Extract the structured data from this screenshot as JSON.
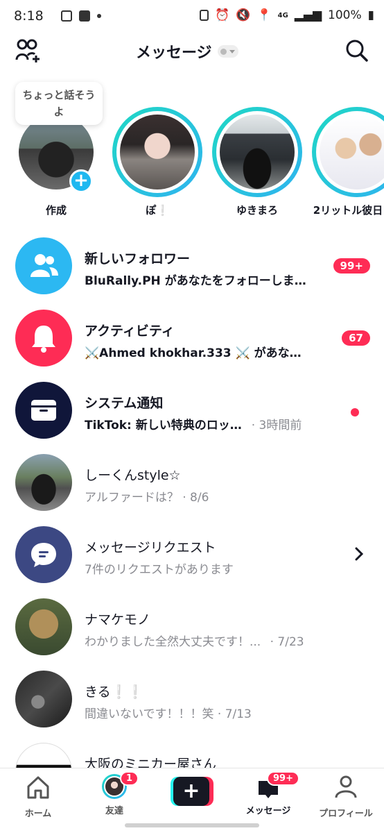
{
  "status_bar": {
    "time": "8:18",
    "battery": "100%",
    "network": "4G"
  },
  "header": {
    "title": "メッセージ"
  },
  "stories": {
    "bubble_text": "ちょっと話そうよ",
    "items": [
      {
        "name": "作成",
        "photo": "car"
      },
      {
        "name": "ぽ❕",
        "photo": "girl"
      },
      {
        "name": "ゆきまろ",
        "photo": "car-ystyle"
      },
      {
        "name": "2リットル彼日",
        "photo": "couple"
      }
    ]
  },
  "list": [
    {
      "title": "新しいフォロワー",
      "subtitle": "BluRally.PH があなたをフォローしま…",
      "badge": "99+",
      "icon": "followers-icon"
    },
    {
      "title": "アクティビティ",
      "subtitle": "⚔️Ahmed khokhar.333 ⚔️ があな…",
      "badge": "67",
      "icon": "bell-icon"
    },
    {
      "title": "システム通知",
      "subtitle": "TikTok: 新しい特典のロッ…",
      "time": "· 3時間前",
      "icon": "inbox-icon"
    },
    {
      "title": "しーくんstyle☆",
      "subtitle": "アルファードは？ · 8/6"
    },
    {
      "title": "メッセージリクエスト",
      "subtitle": "7件のリクエストがあります",
      "icon": "chat-bubble-icon"
    },
    {
      "title": "ナマケモノ",
      "subtitle": "わかりました全然大丈夫です！...",
      "time": "· 7/23"
    },
    {
      "title": "きる❕❕",
      "subtitle": "間違いないです！！！笑 · 7/13"
    },
    {
      "title": "大阪のミニカー屋さん",
      "subtitle": ""
    }
  ],
  "bottom_nav": {
    "home": "ホーム",
    "friends": "友達",
    "friends_badge": "1",
    "create": "+",
    "messages": "メッセージ",
    "messages_badge": "99+",
    "profile": "プロフィール"
  },
  "colors": {
    "accent": "#fe2c55",
    "followers": "#2cb8f2",
    "activity": "#fe2c55",
    "system": "#10163a",
    "request": "#3c4883"
  }
}
